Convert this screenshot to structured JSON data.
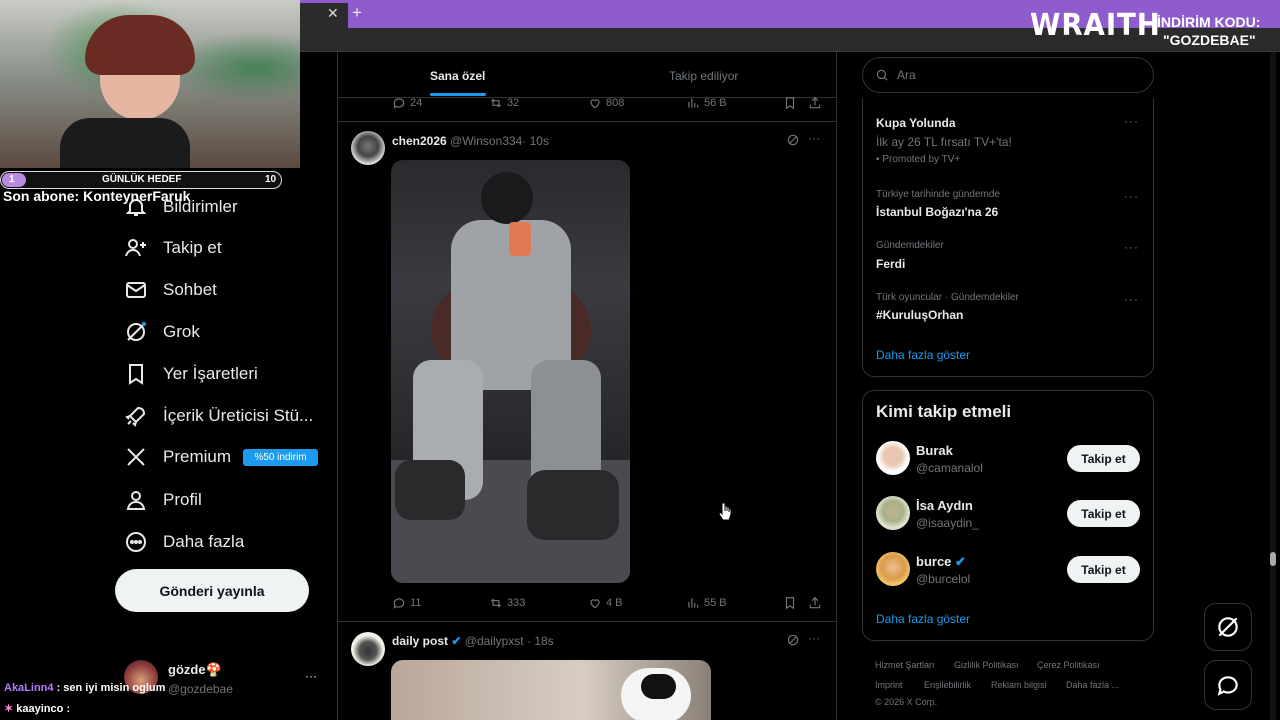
{
  "overlay": {
    "brand": "WRAITH",
    "promo_label": "İNDİRİM KODU:",
    "promo_code": "\"GOZDEBAE\""
  },
  "stream": {
    "goal_label": "GÜNLÜK HEDEF",
    "goal_current": "1",
    "goal_target": "10",
    "last_sub": "Son abone: KonteynerFaruk",
    "chat": [
      {
        "user": "AkaLinn4",
        "message": ": sen iyi misin oglum",
        "color": "#b57cff"
      },
      {
        "user": "kaayinco",
        "message": ":",
        "color": "#ffffff"
      }
    ]
  },
  "nav": {
    "items": [
      {
        "label": "Bildirimler",
        "icon": "bell-icon"
      },
      {
        "label": "Takip et",
        "icon": "person-plus-icon"
      },
      {
        "label": "Sohbet",
        "icon": "mail-icon"
      },
      {
        "label": "Grok",
        "icon": "grok-icon"
      },
      {
        "label": "Yer İşaretleri",
        "icon": "bookmark-icon"
      },
      {
        "label": "İçerik Üreticisi Stü...",
        "icon": "rocket-icon"
      },
      {
        "label": "Premium",
        "icon": "x-logo-icon"
      },
      {
        "label": "Profil",
        "icon": "person-icon"
      },
      {
        "label": "Daha fazla",
        "icon": "more-circle-icon"
      }
    ],
    "premium_badge": "%50 indirim",
    "post_button": "Gönderi yayınla",
    "account_name": "gözde🍄",
    "account_handle": "@gozdebae"
  },
  "feed": {
    "tabs": [
      "Sana özel",
      "Takip ediliyor"
    ],
    "active_tab": 0,
    "prev_post_actions": {
      "replies": "24",
      "reposts": "32",
      "likes": "808",
      "views": "56 B"
    },
    "posts": [
      {
        "name": "chen2026",
        "handle": "@Winson334",
        "time": "· 10s",
        "replies": "11",
        "reposts": "333",
        "likes": "4 B",
        "views": "55 B"
      },
      {
        "name": "daily post",
        "handle": "@dailypxst",
        "time": "· 18s",
        "verified": true
      }
    ]
  },
  "sidebar": {
    "search_placeholder": "Ara",
    "trends": [
      {
        "meta": "",
        "title": "Kupa Yolunda",
        "sub": "İlk ay 26 TL fırsatı TV+'ta!",
        "promo": "Promoted by TV+"
      },
      {
        "meta": "Türkiye tarihinde gündemde",
        "title": "İstanbul Boğazı'na 26"
      },
      {
        "meta": "Gündemdekiler",
        "title": "Ferdi"
      },
      {
        "meta": "Türk oyuncular · Gündemdekiler",
        "title": "#KuruluşOrhan"
      }
    ],
    "trends_more": "Daha fazla göster",
    "who_to_follow_title": "Kimi takip etmeli",
    "follow_suggestions": [
      {
        "name": "Burak",
        "handle": "@camanalol",
        "button": "Takip et"
      },
      {
        "name": "İsa Aydın",
        "handle": "@isaaydin_",
        "button": "Takip et"
      },
      {
        "name": "burce",
        "handle": "@burcelol",
        "button": "Takip et",
        "verified": true
      }
    ],
    "follow_more": "Daha fazla göster",
    "footer": {
      "links_row1": [
        "Hizmet Şartları",
        "Gizlilik Politikası",
        "Çerez Politikası"
      ],
      "links_row2": [
        "Imprint",
        "Erişilebilirlik",
        "Reklam bilgisi",
        "Daha fazla ..."
      ],
      "copyright": "© 2026 X Corp."
    }
  },
  "colors": {
    "accent": "#1d9bf0",
    "browser_bar": "#8e5ccc",
    "border": "#2f3336"
  }
}
